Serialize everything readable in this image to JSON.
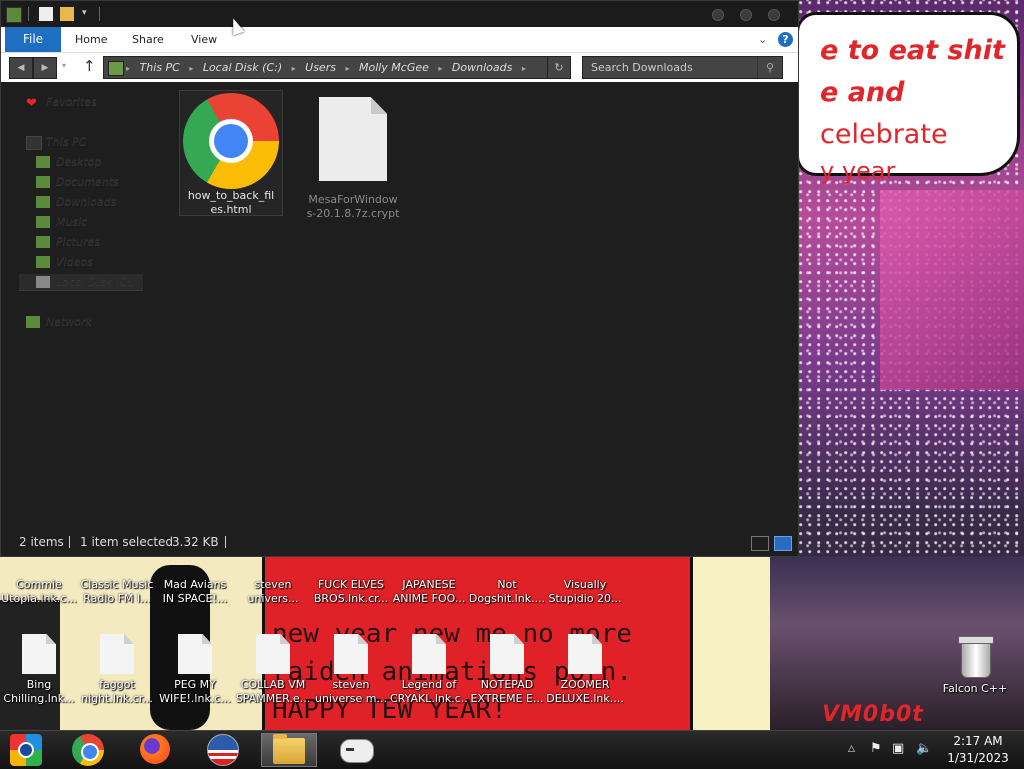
{
  "explorer": {
    "ribbon_tabs": {
      "file": "File",
      "home": "Home",
      "share": "Share",
      "view": "View"
    },
    "help_label": "?",
    "address_crumbs": [
      "This PC",
      "Local Disk (C:)",
      "Users",
      "Molly McGee",
      "Downloads"
    ],
    "search_placeholder": "Search Downloads",
    "nav_pane": {
      "favorites": "Favorites",
      "this_pc": "This PC",
      "items": [
        "Desktop",
        "Documents",
        "Downloads",
        "Music",
        "Pictures",
        "Videos",
        "Local Disk (C:)"
      ],
      "network": "Network"
    },
    "files": [
      {
        "name_line1": "how_to_back_fil",
        "name_line2": "es.html",
        "icon": "chrome-icon",
        "selected": true
      },
      {
        "name_line1": "MesaForWindow",
        "name_line2": "s-20.1.8.7z.crypt",
        "icon": "file-icon",
        "selected": false
      }
    ],
    "status": {
      "items": "2 items",
      "selected": "1 item selected",
      "size": "3.32 KB"
    }
  },
  "wallpaper": {
    "bubble_line1": "e to eat shit",
    "bubble_line2a": "e and",
    "bubble_line2b": "celebrate",
    "bubble_line3": "y year",
    "comic_line1": "new year new me no more",
    "comic_line2": "raiden animations porn.",
    "comic_line3": "HAPPY TEW YEAR!",
    "watermark": "VM0b0t"
  },
  "desktop": {
    "row1": [
      {
        "l1": "Commie",
        "l2": "Utopia.lnk.c..."
      },
      {
        "l1": "Classic Music",
        "l2": "Radio FM I..."
      },
      {
        "l1": "Mad Avians",
        "l2": "IN SPACE!..."
      },
      {
        "l1": "steven",
        "l2": "univers..."
      },
      {
        "l1": "FUCK ELVES",
        "l2": "BROS.lnk.cr..."
      },
      {
        "l1": "JAPANESE",
        "l2": "ANIME FOO..."
      },
      {
        "l1": "Not",
        "l2": "Dogshit.lnk...."
      },
      {
        "l1": "Visually",
        "l2": "Stupidio 20..."
      }
    ],
    "row2": [
      {
        "l1": "Bing",
        "l2": "Chilling.lnk..."
      },
      {
        "l1": "faggot",
        "l2": "night.lnk.cr..."
      },
      {
        "l1": "PEG MY",
        "l2": "WIFE!.lnk.c..."
      },
      {
        "l1": "COLLAB VM",
        "l2": "SPAMMER.e..."
      },
      {
        "l1": "steven",
        "l2": "universe m..."
      },
      {
        "l1": "Legend of",
        "l2": "CRYAKL.lnk.c..."
      },
      {
        "l1": "NOTEPAD",
        "l2": "EXTREME E..."
      },
      {
        "l1": "ZOOMER",
        "l2": "DELUXE.lnk...."
      }
    ],
    "recycle_label": "Falcon C++"
  },
  "taskbar": {
    "clock_time": "2:17 AM",
    "clock_date": "1/31/2023"
  }
}
